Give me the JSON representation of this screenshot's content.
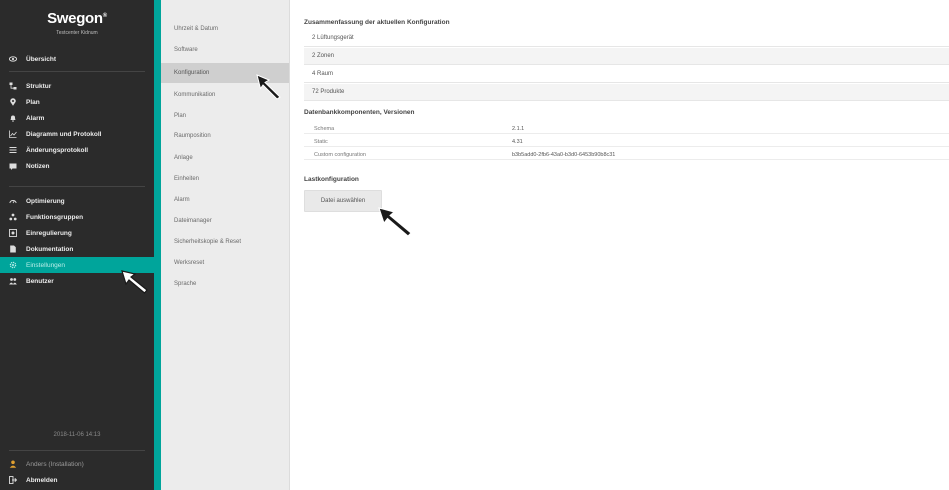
{
  "brand": {
    "name": "Swegon",
    "mark": "®",
    "subtitle": "Testcenter Kidnum"
  },
  "sidebar": {
    "items": [
      {
        "label": "Übersicht",
        "icon": "eye-icon"
      },
      {
        "label": "Struktur",
        "icon": "structure-icon"
      },
      {
        "label": "Plan",
        "icon": "map-pin-icon"
      },
      {
        "label": "Alarm",
        "icon": "bell-icon"
      },
      {
        "label": "Diagramm und Protokoll",
        "icon": "chart-icon"
      },
      {
        "label": "Änderungsprotokoll",
        "icon": "list-icon"
      },
      {
        "label": "Notizen",
        "icon": "note-icon"
      },
      {
        "label": "Optimierung",
        "icon": "gauge-icon"
      },
      {
        "label": "Funktionsgruppen",
        "icon": "groups-icon"
      },
      {
        "label": "Einregulierung",
        "icon": "balance-icon"
      },
      {
        "label": "Dokumentation",
        "icon": "document-icon"
      },
      {
        "label": "Einstellungen",
        "icon": "gear-icon",
        "active": true
      },
      {
        "label": "Benutzer",
        "icon": "users-icon"
      }
    ],
    "footer_date": "2018-11-06 14:13",
    "user": "Anders (Installation)",
    "logout": "Abmelden"
  },
  "submenu": {
    "items": [
      "Uhrzeit & Datum",
      "Software",
      "Konfiguration",
      "Kommunikation",
      "Plan",
      "Raumposition",
      "Anlage",
      "Einheiten",
      "Alarm",
      "Dateimanager",
      "Sicherheitskopie & Reset",
      "Werksreset",
      "Sprache"
    ],
    "active_index": 2
  },
  "main": {
    "summary_title": "Zusammenfassung der aktuellen Konfiguration",
    "summary_rows": [
      "2 Lüftungsgerät",
      "2 Zonen",
      "4 Raum",
      "72 Produkte"
    ],
    "db_title": "Datenbankkomponenten, Versionen",
    "db_rows": [
      {
        "key": "Schema",
        "value": "2.1.1"
      },
      {
        "key": "Static",
        "value": "4.31"
      },
      {
        "key": "Custom configuration",
        "value": "b3b5add0-2fb6-43a0-b3d0-6453b90b8c31"
      }
    ],
    "load_title": "Lastkonfiguration",
    "file_button": "Datei auswählen"
  },
  "colors": {
    "accent": "#00a59b",
    "sidebar_bg": "#2b2b2b",
    "submenu_bg": "#ececec"
  }
}
